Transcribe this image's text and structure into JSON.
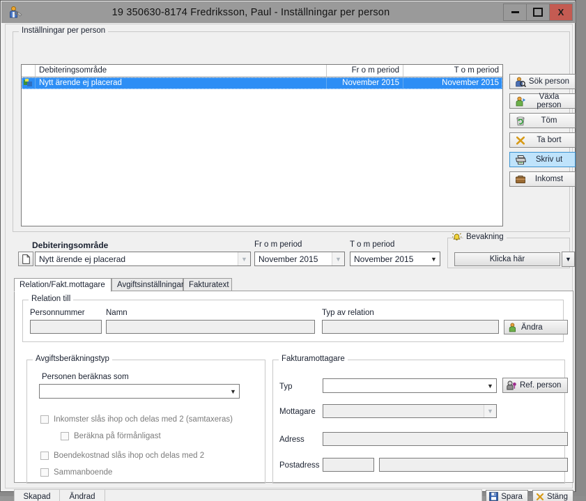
{
  "window": {
    "title": "19 350630-8174  Fredriksson, Paul   -   Inställningar per person",
    "app_icon": "person-settings-icon",
    "controls": {
      "minimize": "minimize-icon",
      "maximize": "maximize-icon",
      "close": "X"
    }
  },
  "list_group": {
    "legend": "Inställningar per person",
    "columns": [
      "",
      "Debiteringsområde",
      "Fr o m period",
      "T o m period"
    ],
    "rows": [
      {
        "icon": "item-icon",
        "area": "Nytt ärende ej placerad",
        "from_period": "November 2015",
        "to_period": "November 2015",
        "selected": true
      }
    ]
  },
  "side_buttons": [
    {
      "label": "Sök person",
      "icon": "search-person-icon",
      "highlighted": false
    },
    {
      "label": "Växla person",
      "icon": "switch-person-icon",
      "highlighted": false
    },
    {
      "label": "Töm",
      "icon": "recycle-bin-icon",
      "highlighted": false
    },
    {
      "label": "Ta bort",
      "icon": "delete-x-icon",
      "highlighted": false
    },
    {
      "label": "Skriv ut",
      "icon": "printer-icon",
      "highlighted": true
    },
    {
      "label": "Inkomst",
      "icon": "briefcase-icon",
      "highlighted": false
    }
  ],
  "detail_bar": {
    "area_label": "Debiteringsområde",
    "area_value": "Nytt ärende ej placerad",
    "new_doc_icon": "new-document-icon",
    "from_label": "Fr o m period",
    "from_value": "November 2015",
    "to_label": "T o m period",
    "to_value": "November 2015",
    "watch": {
      "legend": "Bevakning",
      "icon": "alarm-bell-icon",
      "button_label": "Klicka här",
      "dropdown_icon": "chevron-down-icon"
    }
  },
  "tabs": [
    {
      "label": "Relation/Fakt.mottagare",
      "active": true
    },
    {
      "label": "Avgiftsinställningar",
      "active": false
    },
    {
      "label": "Fakturatext",
      "active": false
    }
  ],
  "relation_group": {
    "legend": "Relation till",
    "personnummer_label": "Personnummer",
    "personnummer_value": "",
    "namn_label": "Namn",
    "namn_value": "",
    "typ_label": "Typ av relation",
    "typ_value": "",
    "edit_button": {
      "label": "Ändra",
      "icon": "person-edit-icon"
    }
  },
  "fee_group": {
    "legend": "Avgiftsberäkningstyp",
    "calc_label": "Personen beräknas som",
    "calc_value": "",
    "checkboxes": [
      {
        "label": "Inkomster slås ihop och delas med 2 (samtaxeras)",
        "checked": false,
        "indent": 0
      },
      {
        "label": "Beräkna på förmånligast",
        "checked": false,
        "indent": 1
      },
      {
        "label": "Boendekostnad slås ihop och delas med 2",
        "checked": false,
        "indent": 0
      },
      {
        "label": "Sammanboende",
        "checked": false,
        "indent": 0
      }
    ]
  },
  "invoice_group": {
    "legend": "Fakturamottagare",
    "typ_label": "Typ",
    "typ_value": "",
    "ref_button": {
      "label": "Ref. person",
      "icon": "ref-person-icon"
    },
    "mottagare_label": "Mottagare",
    "mottagare_value": "",
    "adress_label": "Adress",
    "adress_value": "",
    "postadress_label": "Postadress",
    "postnr_value": "",
    "postort_value": ""
  },
  "statusbar": {
    "created_label": "Skapad",
    "changed_label": "Ändrad",
    "message": "",
    "save_button": {
      "label": "Spara",
      "icon": "save-floppy-icon"
    },
    "close_button": {
      "label": "Stäng",
      "icon": "close-x-icon"
    }
  },
  "colors": {
    "selection_blue": "#2d8ef5",
    "highlight_blue": "#bfe3fb",
    "titlebar_gray": "#9a9a9a",
    "close_red": "#c45b52",
    "window_bg": "#f0f0f0"
  }
}
